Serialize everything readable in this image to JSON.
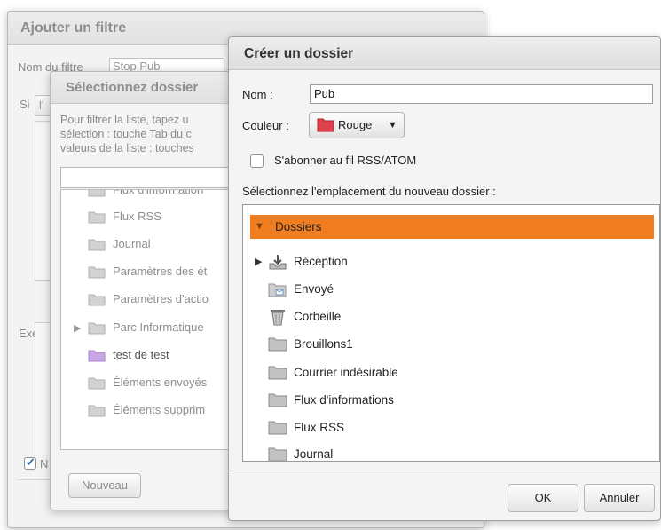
{
  "filter_dialog": {
    "title": "Ajouter un filtre",
    "name_label": "Nom du filtre",
    "name_value": "Stop Pub",
    "if_label": "Si",
    "if_value": "l'",
    "exec_label": "Exéc",
    "n_checkbox_label": "N"
  },
  "select_folder_dialog": {
    "title": "Sélectionnez dossier",
    "help_lines": [
      "Pour filtrer la liste, tapez u",
      "sélection : touche Tab du c",
      "valeurs de la liste : touches"
    ],
    "items": [
      {
        "label": "Flux d'information",
        "icon": "folder-icon"
      },
      {
        "label": "Flux RSS",
        "icon": "folder-icon"
      },
      {
        "label": "Journal",
        "icon": "folder-icon"
      },
      {
        "label": "Paramètres des ét",
        "icon": "folder-icon"
      },
      {
        "label": "Paramètres d'actio",
        "icon": "folder-icon"
      },
      {
        "label": "Parc Informatique",
        "icon": "folder-icon"
      },
      {
        "label": "test de test",
        "icon": "folder-icon"
      },
      {
        "label": "Éléments envoyés",
        "icon": "folder-icon"
      },
      {
        "label": "Éléments supprim",
        "icon": "folder-icon"
      }
    ],
    "new_button": "Nouveau"
  },
  "create_folder_dialog": {
    "title": "Créer un dossier",
    "name_label": "Nom :",
    "name_value": "Pub",
    "color_label": "Couleur :",
    "color_value": "Rouge",
    "subscribe_label": "S'abonner au fil RSS/ATOM",
    "subscribe_checked": false,
    "location_label": "Sélectionnez l'emplacement du nouveau dossier :",
    "tree_root": "Dossiers",
    "tree_items": [
      {
        "label": "Réception",
        "icon": "inbox-icon"
      },
      {
        "label": "Envoyé",
        "icon": "sent-icon"
      },
      {
        "label": "Corbeille",
        "icon": "trash-icon"
      },
      {
        "label": "Brouillons1",
        "icon": "folder-icon"
      },
      {
        "label": "Courrier indésirable",
        "icon": "folder-icon"
      },
      {
        "label": "Flux d'informations",
        "icon": "folder-icon"
      },
      {
        "label": "Flux RSS",
        "icon": "folder-icon"
      },
      {
        "label": "Journal",
        "icon": "folder-icon"
      }
    ],
    "ok_button": "OK",
    "cancel_button": "Annuler"
  },
  "colors": {
    "selection_orange": "#f07d1f",
    "red_swatch": "#e0424d",
    "purple_folder": "#c9a6e6"
  }
}
